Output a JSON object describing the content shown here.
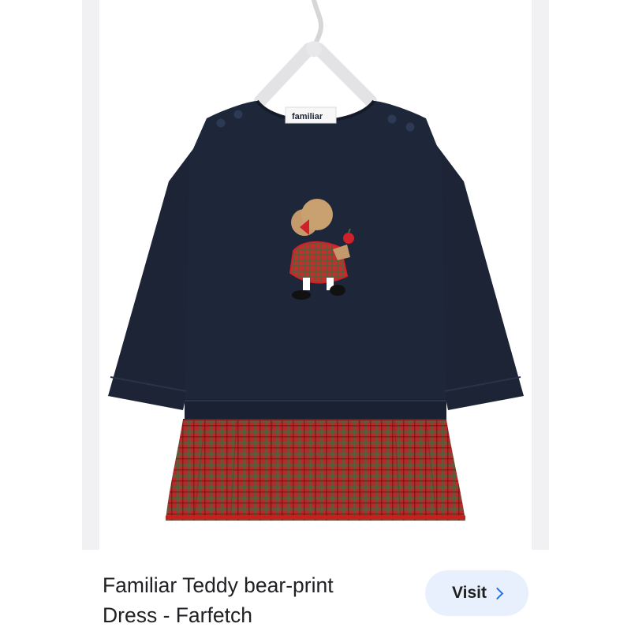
{
  "result": {
    "title_line1": "Familiar Teddy bear-print",
    "title_line2": "Dress - Farfetch",
    "visit_label": "Visit",
    "visit_icon": "chevron-right-icon"
  },
  "image": {
    "brand_tag": "familiar"
  },
  "colors": {
    "garment_navy": "#1c2436",
    "plaid_red": "#b52a2a",
    "plaid_green": "#3d6b3e",
    "visit_bg": "#e8f0fe",
    "visit_chevron": "#1a73e8"
  }
}
